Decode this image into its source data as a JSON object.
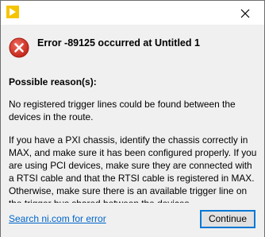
{
  "window": {
    "app_icon": "labview-run-arrow-icon",
    "close_icon": "close-x-icon"
  },
  "dialog": {
    "icon": "error-x-icon",
    "title": "Error -89125 occurred at Untitled 1",
    "reason_heading": "Possible reason(s):",
    "paragraph1": "No registered trigger lines could be found between the devices in the route.",
    "paragraph2": "If you have a PXI chassis, identify the chassis correctly in MAX, and make sure it has been configured properly. If you are using PCI devices, make sure they are connected with a RTSI cable and that the RTSI cable is registered in MAX. Otherwise, make sure there is an available trigger line on the trigger bus shared between the devices."
  },
  "footer": {
    "help_link": "Search ni.com for error",
    "continue_label": "Continue"
  },
  "colors": {
    "content_bg": "#f0f0f0",
    "error_red": "#d52b1e",
    "link_blue": "#0066cc",
    "button_border": "#0078d7",
    "app_icon_yellow": "#f5c400"
  }
}
